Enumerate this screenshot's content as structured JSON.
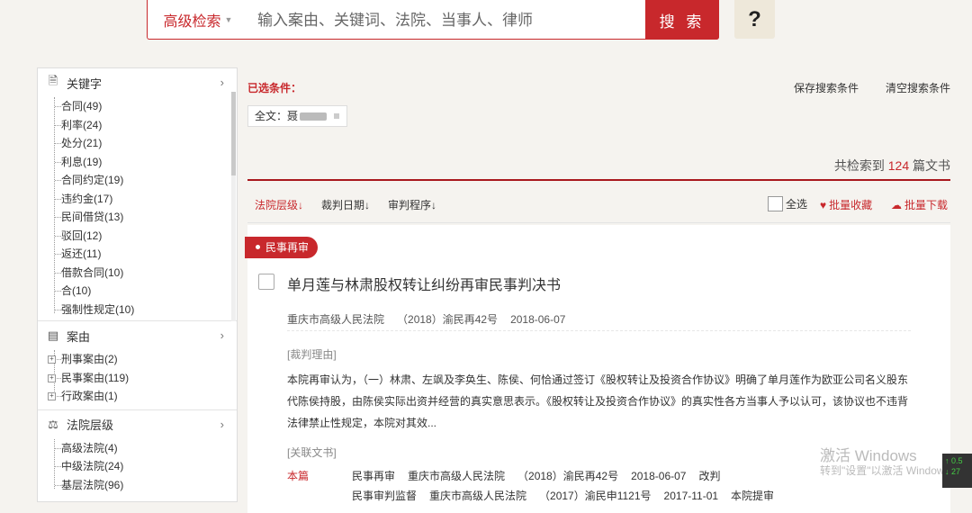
{
  "search": {
    "advanced_label": "高级检索",
    "placeholder": "输入案由、关键词、法院、当事人、律师",
    "button_label": "搜 索",
    "help_label": "?"
  },
  "sidebar": {
    "keywords": {
      "title": "关键字",
      "items": [
        "合同(49)",
        "利率(24)",
        "处分(21)",
        "利息(19)",
        "合同约定(19)",
        "违约金(17)",
        "民间借贷(13)",
        "驳回(12)",
        "返还(11)",
        "借款合同(10)",
        "合(10)",
        "强制性规定(10)"
      ]
    },
    "cause": {
      "title": "案由",
      "items": [
        "刑事案由(2)",
        "民事案由(119)",
        "行政案由(1)"
      ]
    },
    "court_level": {
      "title": "法院层级",
      "items": [
        "高级法院(4)",
        "中级法院(24)",
        "基层法院(96)"
      ]
    }
  },
  "main": {
    "selected_label": "已选条件：",
    "save_label": "保存搜索条件",
    "clear_label": "清空搜索条件",
    "chip_label": "全文：聂",
    "count_prefix": "共检索到 ",
    "count_value": "124",
    "count_suffix": " 篇文书",
    "sorts": [
      "法院层级",
      "裁判日期",
      "审判程序"
    ],
    "sort_arrow": "↓",
    "select_all": "全选",
    "batch_fav": "批量收藏",
    "batch_download": "批量下载"
  },
  "result": {
    "badge": "民事再审",
    "title": "单月莲与林肃股权转让纠纷再审民事判决书",
    "court": "重庆市高级人民法院",
    "case_no": "（2018）渝民再42号",
    "date": "2018-06-07",
    "reason_label": "[裁判理由]",
    "reason_text": "本院再审认为，（一）林肃、左飒及李奂生、陈侯、何恰通过签订《股权转让及投资合作协议》明确了单月莲作为欧亚公司名义股东代陈侯持股，由陈侯实际出资并经营的真实意思表示。《股权转让及投资合作协议》的真实性各方当事人予以认可，该协议也不违背法律禁止性规定，本院对其效...",
    "related_label": "[关联文书]",
    "related": [
      {
        "tag": "本篇",
        "type": "民事再审",
        "court": "重庆市高级人民法院",
        "case_no": "（2018）渝民再42号",
        "date": "2018-06-07",
        "result": "改判"
      },
      {
        "tag": "",
        "type": "民事审判监督",
        "court": "重庆市高级人民法院",
        "case_no": "（2017）渝民申1121号",
        "date": "2017-11-01",
        "result": "本院提审"
      }
    ]
  },
  "watermark": {
    "line1": "激活 Windows",
    "line2": "转到\"设置\"以激活 Windows。"
  },
  "speed": {
    "up": "↑ 0.5",
    "down": "↓ 27"
  }
}
